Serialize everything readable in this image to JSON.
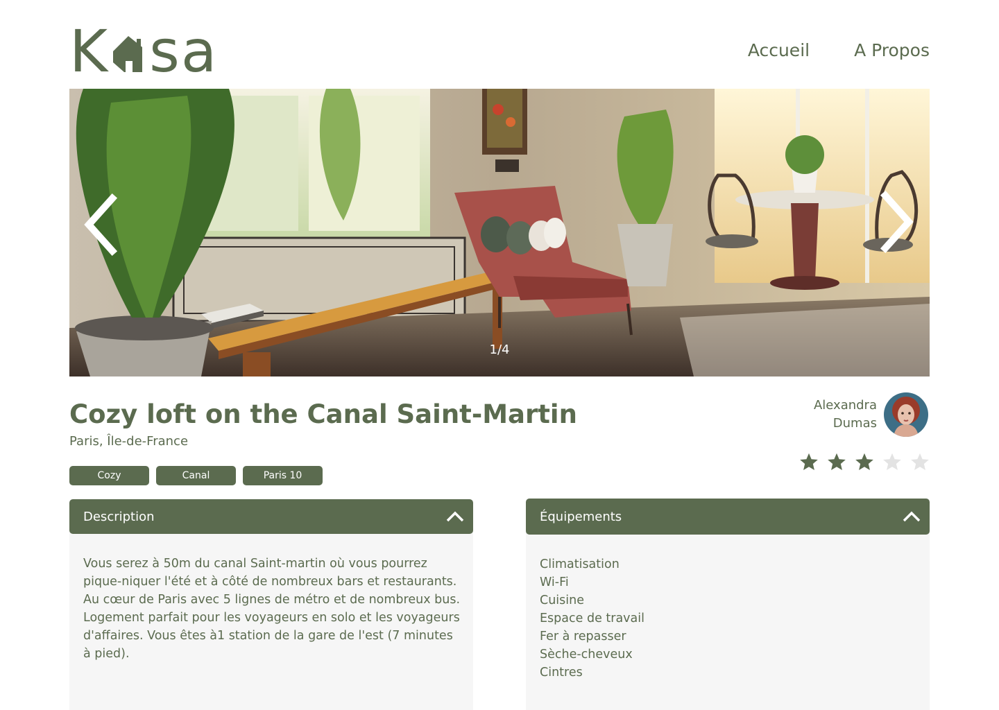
{
  "brand": {
    "logo_text_left": "K",
    "logo_text_right": "sa"
  },
  "nav": {
    "home": "Accueil",
    "about": "A Propos"
  },
  "gallery": {
    "counter": "1/4"
  },
  "listing": {
    "title": "Cozy loft on the Canal Saint-Martin",
    "location": "Paris, Île-de-France",
    "tags": [
      "Cozy",
      "Canal",
      "Paris 10"
    ]
  },
  "host": {
    "first_name": "Alexandra",
    "last_name": "Dumas"
  },
  "rating": {
    "value": 3,
    "max": 5
  },
  "description": {
    "heading": "Description",
    "text": "Vous serez à 50m du canal Saint-martin où vous pourrez pique-niquer l'été et à côté de nombreux bars et restaurants. Au cœur de Paris avec 5 lignes de métro et de nombreux bus. Logement parfait pour les voyageurs en solo et les voyageurs d'affaires. Vous êtes à1 station de la gare de l'est (7 minutes à pied)."
  },
  "equipments": {
    "heading": "Équipements",
    "items": [
      "Climatisation",
      "Wi-Fi",
      "Cuisine",
      "Espace de travail",
      "Fer à repasser",
      "Sèche-cheveux",
      "Cintres"
    ]
  },
  "colors": {
    "primary": "#5b6b4f",
    "panel_bg": "#f6f6f6",
    "star_off": "#e3e3e3"
  }
}
